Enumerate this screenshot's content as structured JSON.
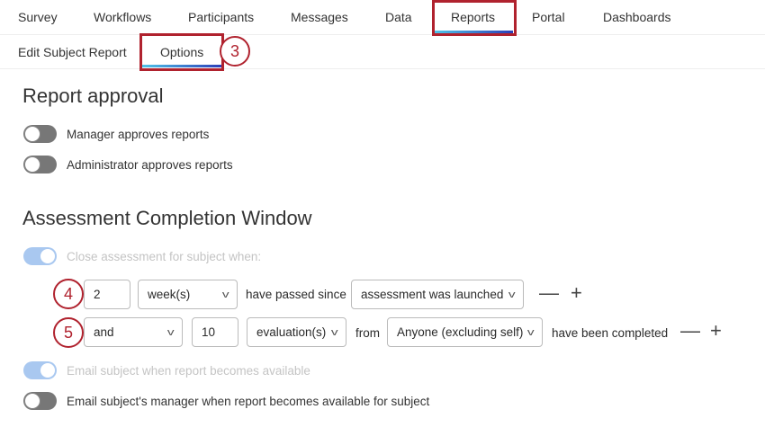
{
  "tabs": [
    "Survey",
    "Workflows",
    "Participants",
    "Messages",
    "Data",
    "Reports",
    "Portal",
    "Dashboards"
  ],
  "subtabs": [
    "Edit Subject Report",
    "Options"
  ],
  "callouts": [
    "3",
    "4",
    "5"
  ],
  "report_approval": {
    "title": "Report approval",
    "manager": "Manager approves reports",
    "admin": "Administrator approves reports"
  },
  "acw": {
    "title": "Assessment Completion Window",
    "close_label": "Close assessment for subject when:",
    "row1": {
      "amount": "2",
      "unit": "week(s)",
      "text": "have passed since",
      "since": "assessment was launched"
    },
    "row2": {
      "conj": "and",
      "count": "10",
      "type": "evaluation(s)",
      "from": "from",
      "who": "Anyone (excluding self)",
      "text": "have been completed"
    },
    "minus": "—",
    "plus": "+",
    "email_subject": "Email subject when report becomes available",
    "email_manager": "Email subject's manager when report becomes available for subject"
  }
}
